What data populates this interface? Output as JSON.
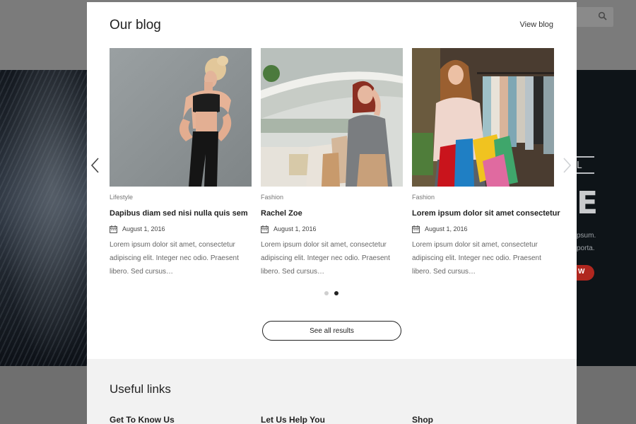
{
  "background": {
    "hero_letters": [
      "L",
      "E"
    ],
    "hero_text_lines": [
      "psum.",
      "porta."
    ],
    "hero_button_label": "W"
  },
  "blog": {
    "title": "Our blog",
    "view_blog_label": "View blog",
    "posts": [
      {
        "category": "Lifestyle",
        "title": "Dapibus diam sed nisi nulla quis sem",
        "date": "August 1, 2016",
        "excerpt": "Lorem ipsum dolor sit amet, consectetur adipiscing elit. Integer nec odio. Praesent libero. Sed cursus…",
        "image": "woman-fitness-photo"
      },
      {
        "category": "Fashion",
        "title": "Rachel Zoe",
        "date": "August 1, 2016",
        "excerpt": "Lorem ipsum dolor sit amet, consectetur adipiscing elit. Integer nec odio. Praesent libero. Sed cursus…",
        "image": "woman-shopping-mall-photo"
      },
      {
        "category": "Fashion",
        "title": "Lorem ipsum dolor sit amet consectetur",
        "date": "August 1, 2016",
        "excerpt": "Lorem ipsum dolor sit amet, consectetur adipiscing elit. Integer nec odio. Praesent libero. Sed cursus…",
        "image": "woman-shopping-bags-photo"
      }
    ],
    "pagination": {
      "page_count": 2,
      "active_page": 2
    },
    "see_all_label": "See all results"
  },
  "useful_links": {
    "title": "Useful links",
    "columns": [
      "Get To Know Us",
      "Let Us Help You",
      "Shop"
    ]
  },
  "colors": {
    "accent_red": "#b0271f",
    "panel_bg": "#ffffff",
    "footer_bg": "#f2f2f2"
  },
  "icons": [
    "search-icon",
    "calendar-icon",
    "chevron-left-icon",
    "chevron-right-icon"
  ]
}
